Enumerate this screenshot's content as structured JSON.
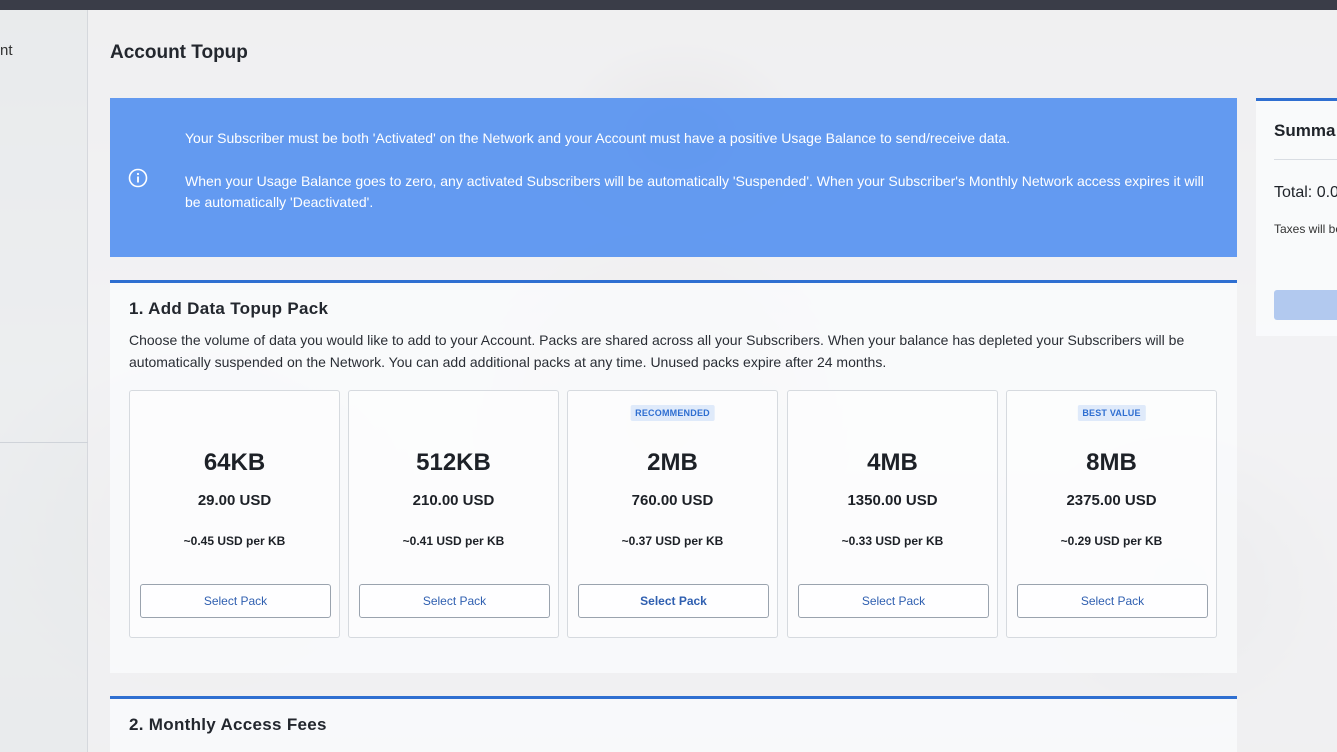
{
  "left_panel": {
    "fragment": "nt"
  },
  "page": {
    "title": "Account Topup"
  },
  "alert": {
    "icon": "info-icon",
    "line1": "Your Subscriber must be both 'Activated' on the Network and your Account must have a positive Usage Balance to send/receive data.",
    "line2": "When your Usage Balance goes to zero, any activated Subscribers will be automatically 'Suspended'. When your Subscriber's Monthly Network access expires it will be automatically 'Deactivated'.",
    "color": "#4c8cf0"
  },
  "summary": {
    "title": "Summa",
    "total": "Total: 0.0",
    "tax_note": "Taxes will be checkout"
  },
  "section1": {
    "title": "1. Add Data Topup Pack",
    "description": "Choose the volume of data you would like to add to your Account. Packs are shared across all your Subscribers. When your balance has depleted your Subscribers will be automatically suspended on the Network. You can add additional packs at any time. Unused packs expire after 24 months.",
    "packs": [
      {
        "badge": "",
        "size": "64KB",
        "price": "29.00 USD",
        "per": "~0.45 USD per KB",
        "button": "Select Pack"
      },
      {
        "badge": "",
        "size": "512KB",
        "price": "210.00 USD",
        "per": "~0.41 USD per KB",
        "button": "Select Pack"
      },
      {
        "badge": "RECOMMENDED",
        "size": "2MB",
        "price": "760.00 USD",
        "per": "~0.37 USD per KB",
        "button": "Select Pack"
      },
      {
        "badge": "",
        "size": "4MB",
        "price": "1350.00 USD",
        "per": "~0.33 USD per KB",
        "button": "Select Pack"
      },
      {
        "badge": "BEST VALUE",
        "size": "8MB",
        "price": "2375.00 USD",
        "per": "~0.29 USD per KB",
        "button": "Select Pack"
      }
    ]
  },
  "section2": {
    "title": "2. Monthly Access Fees"
  },
  "colors": {
    "accent": "#2f6fd1",
    "alert_bg": "#4c8cf0"
  }
}
